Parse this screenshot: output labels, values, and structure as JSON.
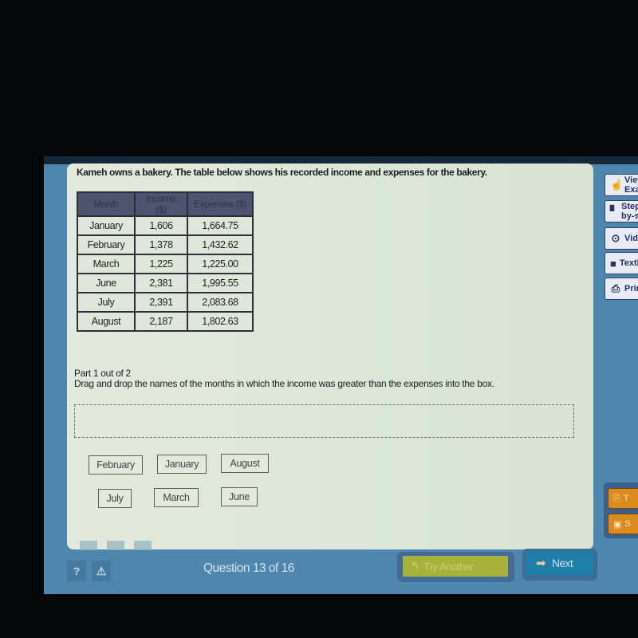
{
  "question": {
    "prompt": "Kameh owns a bakery. The table below shows his recorded income and expenses for the bakery.",
    "table": {
      "headers": [
        "Month",
        "Income ($)",
        "Expenses ($)"
      ],
      "rows": [
        [
          "January",
          "1,606",
          "1,664.75"
        ],
        [
          "February",
          "1,378",
          "1,432.62"
        ],
        [
          "March",
          "1,225",
          "1,225.00"
        ],
        [
          "June",
          "2,381",
          "1,995.55"
        ],
        [
          "July",
          "2,391",
          "2,083.68"
        ],
        [
          "August",
          "2,187",
          "1,802.63"
        ]
      ]
    },
    "part_label": "Part 1 out of 2",
    "instruction": "Drag and drop the names of the months in which the income was greater than the expenses into the box.",
    "choices": [
      "February",
      "January",
      "August",
      "July",
      "March",
      "June"
    ]
  },
  "sidebar": {
    "items": [
      {
        "label": "View an Example",
        "icon": "hand-pointer-icon"
      },
      {
        "label": "Step-by-step",
        "icon": "footprint-icon"
      },
      {
        "label": "Video",
        "icon": "play-circle-icon"
      },
      {
        "label": "Textbook",
        "icon": "book-icon"
      },
      {
        "label": "Print",
        "icon": "printer-icon"
      }
    ],
    "tools": [
      {
        "label": "T",
        "icon": "tools-icon"
      },
      {
        "label": "S",
        "icon": "save-icon"
      }
    ]
  },
  "footer": {
    "help_label": "?",
    "alert_label": "⚠",
    "question_counter": "Question 13 of 16",
    "try_another_label": "Try Another",
    "next_label": "Next"
  }
}
